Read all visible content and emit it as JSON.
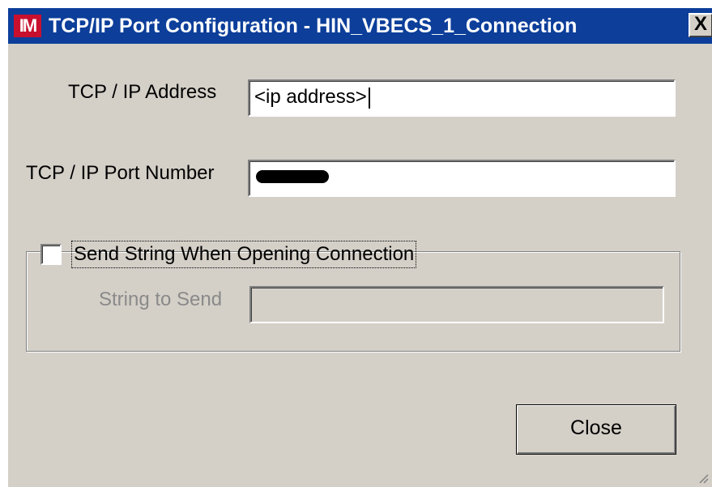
{
  "window": {
    "app_icon_text": "IM",
    "title": "TCP/IP Port Configuration - HIN_VBECS_1_Connection",
    "close_glyph": "X"
  },
  "form": {
    "address_label": "TCP / IP Address",
    "address_value": "<ip address>",
    "port_label": "TCP / IP Port Number",
    "port_value_redacted": true
  },
  "send_string_group": {
    "checkbox_label": "Send String When Opening Connection",
    "checked": false,
    "string_label": "String to Send",
    "string_value": ""
  },
  "buttons": {
    "close_label": "Close"
  },
  "colors": {
    "dialog_bg": "#d4d0c8",
    "titlebar_bg": "#0c3e9a",
    "app_icon_bg": "#c8102e",
    "disabled_text": "#8a8a8a"
  }
}
